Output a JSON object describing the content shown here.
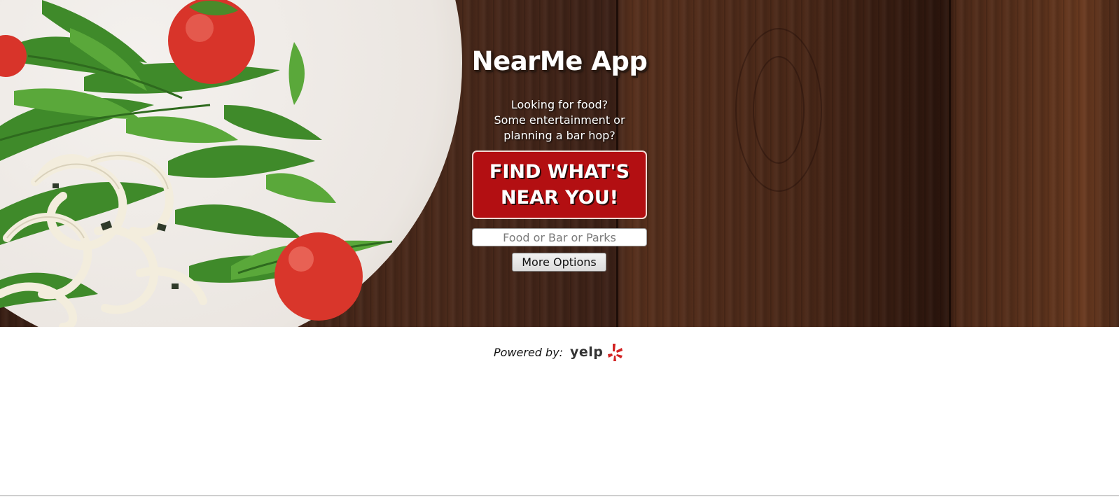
{
  "app": {
    "title": "NearMe App"
  },
  "hero": {
    "tagline_lines": [
      "Looking for food?",
      "Some entertainment or",
      "planning a bar hop?"
    ],
    "cta_lines": [
      "FIND WHAT'S",
      "NEAR YOU!"
    ]
  },
  "search": {
    "value": "",
    "placeholder": "Food or Bar or Parks"
  },
  "more_options": {
    "label": "More Options"
  },
  "footer": {
    "powered_by": "Powered by:",
    "brand": "yelp"
  },
  "colors": {
    "cta_background": "#b30f12",
    "brand_red": "#d32323"
  },
  "icons": {
    "brand_logo": "yelp-burst-icon"
  }
}
